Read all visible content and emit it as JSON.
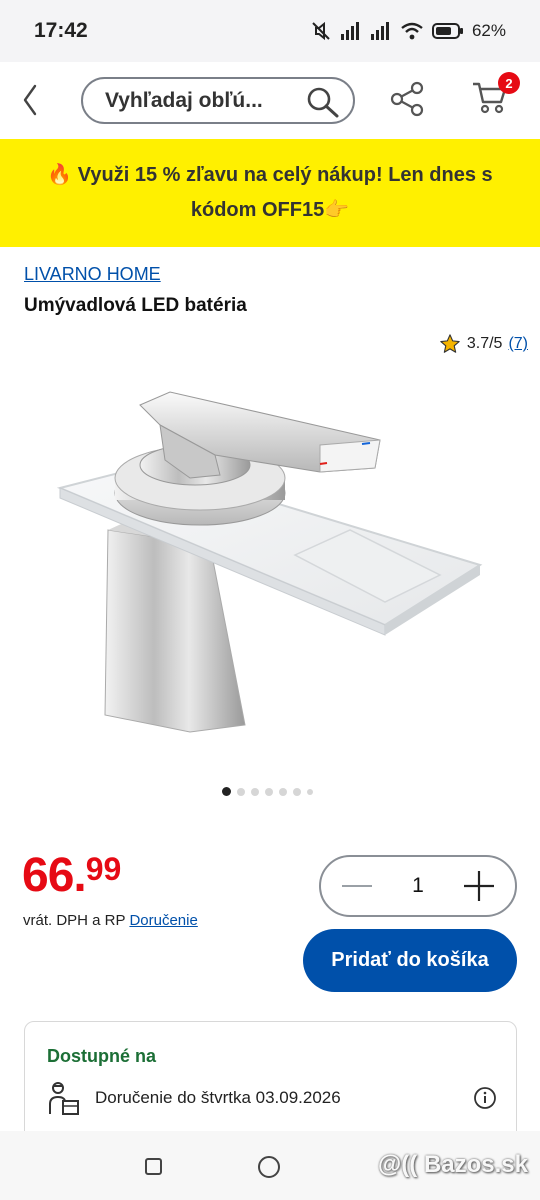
{
  "status_bar": {
    "time": "17:42",
    "battery": "62%"
  },
  "header": {
    "search_placeholder": "Vyhľadaj obľú...",
    "cart_count": "2",
    "icons": {
      "back": "chevron-left-icon",
      "search": "magnifier-icon",
      "share": "share-icon",
      "cart": "cart-icon"
    }
  },
  "promo": {
    "text": "🔥 Využi 15 % zľavu na celý nákup! Len dnes s kódom OFF15👉"
  },
  "product": {
    "brand": "LIVARNO HOME",
    "title": "Umývadlová LED batéria",
    "rating": "3.7/5",
    "rating_count": "(7)",
    "image_count": 7,
    "active_image": 1
  },
  "price": {
    "main": "66.",
    "cents": "99",
    "note": "vrát. DPH a RP",
    "delivery_link": "Doručenie"
  },
  "quantity": {
    "value": "1"
  },
  "cart_button": {
    "label": "Pridať do košíka"
  },
  "availability": {
    "title": "Dostupné na",
    "delivery_text": "Doručenie do štvrtka 03.09.2026"
  },
  "watermark": "@(( Bazos.sk",
  "colors": {
    "brand_blue": "#0050aa",
    "price_red": "#e60a14",
    "promo_yellow": "#fff000",
    "available_green": "#1c6f36"
  }
}
